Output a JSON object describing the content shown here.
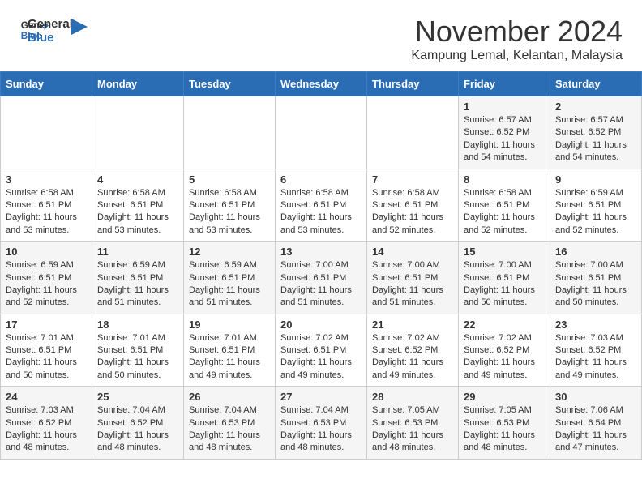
{
  "header": {
    "logo_line1": "General",
    "logo_line2": "Blue",
    "month": "November 2024",
    "location": "Kampung Lemal, Kelantan, Malaysia"
  },
  "weekdays": [
    "Sunday",
    "Monday",
    "Tuesday",
    "Wednesday",
    "Thursday",
    "Friday",
    "Saturday"
  ],
  "weeks": [
    [
      {
        "day": "",
        "info": ""
      },
      {
        "day": "",
        "info": ""
      },
      {
        "day": "",
        "info": ""
      },
      {
        "day": "",
        "info": ""
      },
      {
        "day": "",
        "info": ""
      },
      {
        "day": "1",
        "info": "Sunrise: 6:57 AM\nSunset: 6:52 PM\nDaylight: 11 hours\nand 54 minutes."
      },
      {
        "day": "2",
        "info": "Sunrise: 6:57 AM\nSunset: 6:52 PM\nDaylight: 11 hours\nand 54 minutes."
      }
    ],
    [
      {
        "day": "3",
        "info": "Sunrise: 6:58 AM\nSunset: 6:51 PM\nDaylight: 11 hours\nand 53 minutes."
      },
      {
        "day": "4",
        "info": "Sunrise: 6:58 AM\nSunset: 6:51 PM\nDaylight: 11 hours\nand 53 minutes."
      },
      {
        "day": "5",
        "info": "Sunrise: 6:58 AM\nSunset: 6:51 PM\nDaylight: 11 hours\nand 53 minutes."
      },
      {
        "day": "6",
        "info": "Sunrise: 6:58 AM\nSunset: 6:51 PM\nDaylight: 11 hours\nand 53 minutes."
      },
      {
        "day": "7",
        "info": "Sunrise: 6:58 AM\nSunset: 6:51 PM\nDaylight: 11 hours\nand 52 minutes."
      },
      {
        "day": "8",
        "info": "Sunrise: 6:58 AM\nSunset: 6:51 PM\nDaylight: 11 hours\nand 52 minutes."
      },
      {
        "day": "9",
        "info": "Sunrise: 6:59 AM\nSunset: 6:51 PM\nDaylight: 11 hours\nand 52 minutes."
      }
    ],
    [
      {
        "day": "10",
        "info": "Sunrise: 6:59 AM\nSunset: 6:51 PM\nDaylight: 11 hours\nand 52 minutes."
      },
      {
        "day": "11",
        "info": "Sunrise: 6:59 AM\nSunset: 6:51 PM\nDaylight: 11 hours\nand 51 minutes."
      },
      {
        "day": "12",
        "info": "Sunrise: 6:59 AM\nSunset: 6:51 PM\nDaylight: 11 hours\nand 51 minutes."
      },
      {
        "day": "13",
        "info": "Sunrise: 7:00 AM\nSunset: 6:51 PM\nDaylight: 11 hours\nand 51 minutes."
      },
      {
        "day": "14",
        "info": "Sunrise: 7:00 AM\nSunset: 6:51 PM\nDaylight: 11 hours\nand 51 minutes."
      },
      {
        "day": "15",
        "info": "Sunrise: 7:00 AM\nSunset: 6:51 PM\nDaylight: 11 hours\nand 50 minutes."
      },
      {
        "day": "16",
        "info": "Sunrise: 7:00 AM\nSunset: 6:51 PM\nDaylight: 11 hours\nand 50 minutes."
      }
    ],
    [
      {
        "day": "17",
        "info": "Sunrise: 7:01 AM\nSunset: 6:51 PM\nDaylight: 11 hours\nand 50 minutes."
      },
      {
        "day": "18",
        "info": "Sunrise: 7:01 AM\nSunset: 6:51 PM\nDaylight: 11 hours\nand 50 minutes."
      },
      {
        "day": "19",
        "info": "Sunrise: 7:01 AM\nSunset: 6:51 PM\nDaylight: 11 hours\nand 49 minutes."
      },
      {
        "day": "20",
        "info": "Sunrise: 7:02 AM\nSunset: 6:51 PM\nDaylight: 11 hours\nand 49 minutes."
      },
      {
        "day": "21",
        "info": "Sunrise: 7:02 AM\nSunset: 6:52 PM\nDaylight: 11 hours\nand 49 minutes."
      },
      {
        "day": "22",
        "info": "Sunrise: 7:02 AM\nSunset: 6:52 PM\nDaylight: 11 hours\nand 49 minutes."
      },
      {
        "day": "23",
        "info": "Sunrise: 7:03 AM\nSunset: 6:52 PM\nDaylight: 11 hours\nand 49 minutes."
      }
    ],
    [
      {
        "day": "24",
        "info": "Sunrise: 7:03 AM\nSunset: 6:52 PM\nDaylight: 11 hours\nand 48 minutes."
      },
      {
        "day": "25",
        "info": "Sunrise: 7:04 AM\nSunset: 6:52 PM\nDaylight: 11 hours\nand 48 minutes."
      },
      {
        "day": "26",
        "info": "Sunrise: 7:04 AM\nSunset: 6:53 PM\nDaylight: 11 hours\nand 48 minutes."
      },
      {
        "day": "27",
        "info": "Sunrise: 7:04 AM\nSunset: 6:53 PM\nDaylight: 11 hours\nand 48 minutes."
      },
      {
        "day": "28",
        "info": "Sunrise: 7:05 AM\nSunset: 6:53 PM\nDaylight: 11 hours\nand 48 minutes."
      },
      {
        "day": "29",
        "info": "Sunrise: 7:05 AM\nSunset: 6:53 PM\nDaylight: 11 hours\nand 48 minutes."
      },
      {
        "day": "30",
        "info": "Sunrise: 7:06 AM\nSunset: 6:54 PM\nDaylight: 11 hours\nand 47 minutes."
      }
    ]
  ]
}
